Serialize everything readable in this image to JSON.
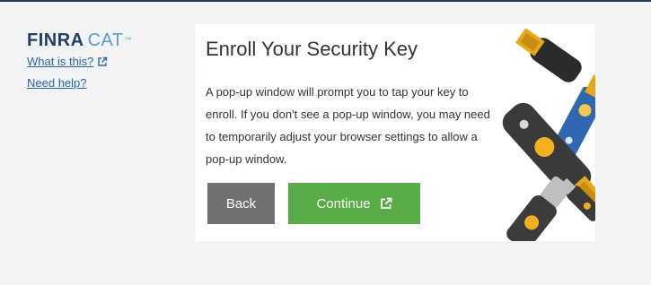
{
  "logo": {
    "brand": "FINRA",
    "product": "CAT",
    "mark": "™"
  },
  "sidebar": {
    "what_is_this": "What is this?",
    "need_help": "Need help?"
  },
  "card": {
    "title": "Enroll Your Security Key",
    "body": "A pop-up window will prompt you to tap your key to enroll. If you don't see a pop-up window, you may need to temporarily adjust your browser settings to allow a pop-up window.",
    "back_label": "Back",
    "continue_label": "Continue"
  },
  "colors": {
    "accent_green": "#5aac46",
    "back_gray": "#707070",
    "link_blue": "#2a66a8",
    "brand_navy": "#1e3f66"
  },
  "icons": [
    "external-link-icon",
    "security-keys-illustration"
  ]
}
